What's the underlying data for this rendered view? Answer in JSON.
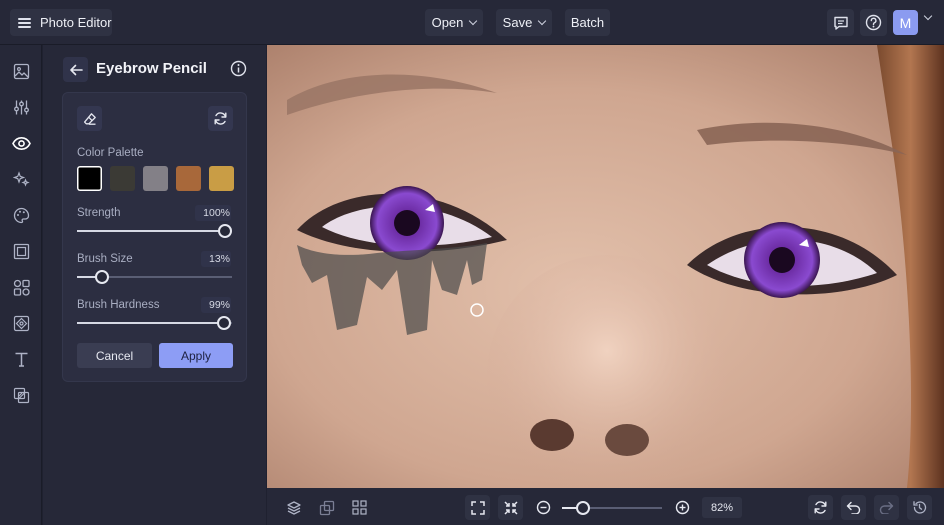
{
  "app": {
    "title": "Photo Editor",
    "avatar_initial": "M"
  },
  "toolbar": {
    "open_label": "Open",
    "save_label": "Save",
    "batch_label": "Batch"
  },
  "panel": {
    "title": "Eyebrow Pencil",
    "palette_label": "Color Palette",
    "palette": [
      "#000000",
      "#3b3a35",
      "#838087",
      "#a8683a",
      "#c99d45"
    ],
    "strength": {
      "label": "Strength",
      "value_text": "100%",
      "value": 100
    },
    "brush_size": {
      "label": "Brush Size",
      "value_text": "13%",
      "value": 13
    },
    "brush_hardness": {
      "label": "Brush Hardness",
      "value_text": "99%",
      "value": 99
    },
    "cancel_label": "Cancel",
    "apply_label": "Apply"
  },
  "zoom": {
    "value_text": "82%",
    "value": 82
  },
  "colors": {
    "accent": "#8d9df5",
    "bg": "#262838",
    "surface": "#2c2e41"
  }
}
